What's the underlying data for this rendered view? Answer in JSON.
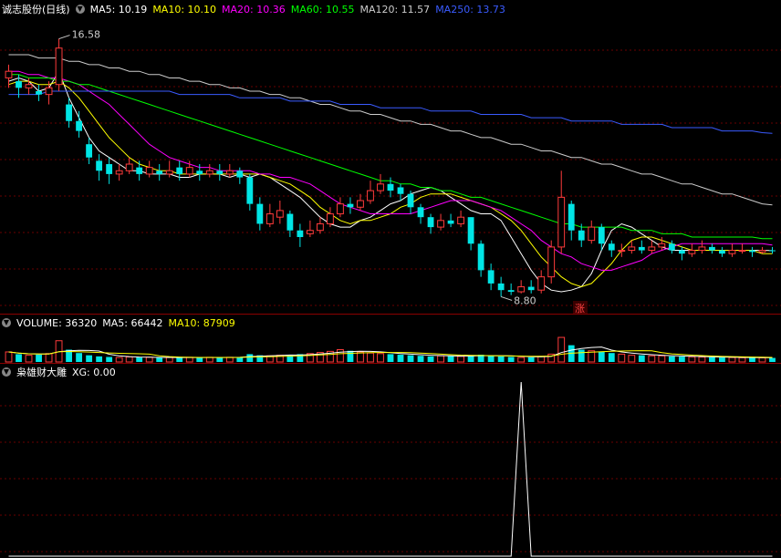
{
  "price_legend": {
    "title": "诚志股份(日线)",
    "items": [
      {
        "label": "MA5: 10.19",
        "color": "#ffffff"
      },
      {
        "label": "MA10: 10.10",
        "color": "#ffff00"
      },
      {
        "label": "MA20: 10.36",
        "color": "#ff00ff"
      },
      {
        "label": "MA60: 10.55",
        "color": "#00ff00"
      },
      {
        "label": "MA120: 11.57",
        "color": "#cccccc"
      },
      {
        "label": "MA250: 13.73",
        "color": "#3a5bff"
      }
    ]
  },
  "price_annotations": {
    "high": "16.58",
    "low": "8.80",
    "tag": "涨"
  },
  "volume_legend": {
    "items": [
      {
        "label": "VOLUME: 36320",
        "color": "#ffffff"
      },
      {
        "label": "MA5: 66442",
        "color": "#ffffff"
      },
      {
        "label": "MA10: 87909",
        "color": "#ffff00"
      }
    ]
  },
  "indicator_legend": {
    "title": "枭雄财大雕",
    "items": [
      {
        "label": "XG: 0.00",
        "color": "#ffffff"
      }
    ]
  },
  "colors": {
    "up": "#ff3b3b",
    "down": "#00e5e5",
    "grid": "#6a0000",
    "separator": "#8a0000"
  },
  "chart_data": {
    "type": "candlestick",
    "price_range": [
      8.4,
      17.2
    ],
    "ma_lines": {
      "ma5": {
        "color": "#ffffff",
        "values": [
          15.3,
          15.4,
          15.3,
          15.0,
          15.1,
          15.6,
          14.8,
          14.2,
          13.6,
          13.2,
          13.0,
          12.8,
          12.6,
          12.6,
          12.5,
          12.5,
          12.5,
          12.4,
          12.4,
          12.5,
          12.5,
          12.5,
          12.4,
          12.5,
          12.4,
          12.5,
          12.4,
          12.2,
          12.0,
          11.8,
          11.5,
          11.2,
          11.0,
          10.9,
          10.9,
          11.1,
          11.2,
          11.4,
          11.6,
          11.7,
          11.9,
          12.0,
          12.1,
          12.0,
          11.8,
          11.6,
          11.4,
          11.3,
          11.3,
          11.1,
          10.6,
          10.1,
          9.6,
          9.2,
          9.0,
          8.95,
          9.0,
          9.1,
          9.5,
          10.2,
          10.8,
          11.0,
          10.9,
          10.7,
          10.5,
          10.3,
          10.2,
          10.2,
          10.2,
          10.2,
          10.2,
          10.2,
          10.2,
          10.2,
          10.2,
          10.2,
          10.19
        ]
      },
      "ma10": {
        "color": "#ffff00",
        "values": [
          15.2,
          15.3,
          15.3,
          15.2,
          15.2,
          15.3,
          15.1,
          14.8,
          14.4,
          14.0,
          13.6,
          13.3,
          13.0,
          12.8,
          12.7,
          12.6,
          12.6,
          12.5,
          12.5,
          12.5,
          12.5,
          12.5,
          12.5,
          12.5,
          12.5,
          12.5,
          12.4,
          12.3,
          12.2,
          12.0,
          11.8,
          11.5,
          11.3,
          11.1,
          11.0,
          11.1,
          11.1,
          11.2,
          11.3,
          11.5,
          11.6,
          11.8,
          11.9,
          11.9,
          11.9,
          11.8,
          11.7,
          11.6,
          11.5,
          11.3,
          11.1,
          10.8,
          10.4,
          10.0,
          9.7,
          9.4,
          9.2,
          9.1,
          9.2,
          9.5,
          9.8,
          10.2,
          10.5,
          10.6,
          10.6,
          10.5,
          10.4,
          10.3,
          10.2,
          10.2,
          10.2,
          10.2,
          10.2,
          10.2,
          10.2,
          10.1,
          10.1
        ]
      },
      "ma20": {
        "color": "#ff00ff",
        "values": [
          15.6,
          15.6,
          15.5,
          15.5,
          15.4,
          15.4,
          15.3,
          15.2,
          15.0,
          14.8,
          14.6,
          14.3,
          14.0,
          13.7,
          13.4,
          13.2,
          13.0,
          12.9,
          12.8,
          12.7,
          12.7,
          12.6,
          12.6,
          12.6,
          12.6,
          12.5,
          12.5,
          12.4,
          12.4,
          12.3,
          12.2,
          12.0,
          11.8,
          11.6,
          11.5,
          11.4,
          11.3,
          11.3,
          11.3,
          11.3,
          11.3,
          11.4,
          11.5,
          11.6,
          11.7,
          11.7,
          11.7,
          11.6,
          11.5,
          11.4,
          11.2,
          11.0,
          10.8,
          10.5,
          10.3,
          10.1,
          10.0,
          9.8,
          9.7,
          9.6,
          9.6,
          9.7,
          9.8,
          9.9,
          10.1,
          10.2,
          10.3,
          10.4,
          10.4,
          10.4,
          10.4,
          10.4,
          10.4,
          10.4,
          10.4,
          10.4,
          10.36
        ]
      },
      "ma60": {
        "color": "#00ff00",
        "values": [
          15.5,
          15.5,
          15.4,
          15.4,
          15.4,
          15.3,
          15.3,
          15.2,
          15.2,
          15.1,
          15.0,
          14.9,
          14.8,
          14.7,
          14.6,
          14.5,
          14.4,
          14.3,
          14.2,
          14.1,
          14.0,
          13.9,
          13.8,
          13.7,
          13.6,
          13.5,
          13.4,
          13.3,
          13.2,
          13.1,
          13.0,
          12.9,
          12.8,
          12.7,
          12.6,
          12.5,
          12.4,
          12.3,
          12.3,
          12.2,
          12.2,
          12.1,
          12.1,
          12.0,
          12.0,
          11.9,
          11.8,
          11.8,
          11.7,
          11.6,
          11.5,
          11.4,
          11.3,
          11.2,
          11.1,
          11.0,
          11.0,
          10.9,
          10.9,
          10.9,
          10.9,
          10.9,
          10.8,
          10.8,
          10.8,
          10.7,
          10.7,
          10.7,
          10.6,
          10.6,
          10.6,
          10.6,
          10.6,
          10.6,
          10.6,
          10.55,
          10.55
        ]
      },
      "ma120": {
        "color": "#cccccc",
        "values": [
          16.1,
          16.1,
          16.1,
          16.0,
          16.0,
          16.0,
          15.9,
          15.9,
          15.8,
          15.8,
          15.7,
          15.7,
          15.6,
          15.6,
          15.5,
          15.5,
          15.4,
          15.4,
          15.3,
          15.3,
          15.2,
          15.2,
          15.1,
          15.1,
          15.0,
          15.0,
          14.9,
          14.9,
          14.8,
          14.8,
          14.7,
          14.6,
          14.6,
          14.5,
          14.4,
          14.4,
          14.3,
          14.3,
          14.2,
          14.1,
          14.1,
          14.0,
          14.0,
          13.9,
          13.8,
          13.8,
          13.7,
          13.6,
          13.6,
          13.5,
          13.4,
          13.4,
          13.3,
          13.2,
          13.2,
          13.1,
          13.0,
          13.0,
          12.9,
          12.8,
          12.8,
          12.7,
          12.6,
          12.5,
          12.5,
          12.4,
          12.3,
          12.2,
          12.2,
          12.1,
          12.0,
          11.9,
          11.9,
          11.8,
          11.7,
          11.6,
          11.57
        ]
      },
      "ma250": {
        "color": "#3a5bff",
        "values": [
          14.9,
          14.9,
          14.9,
          14.9,
          15.0,
          15.0,
          15.0,
          15.0,
          15.0,
          15.0,
          15.0,
          15.0,
          15.0,
          15.0,
          15.0,
          15.0,
          15.0,
          14.9,
          14.9,
          14.9,
          14.9,
          14.9,
          14.9,
          14.8,
          14.8,
          14.8,
          14.8,
          14.8,
          14.7,
          14.7,
          14.7,
          14.7,
          14.7,
          14.6,
          14.6,
          14.6,
          14.6,
          14.5,
          14.5,
          14.5,
          14.5,
          14.5,
          14.4,
          14.4,
          14.4,
          14.4,
          14.4,
          14.3,
          14.3,
          14.3,
          14.3,
          14.3,
          14.2,
          14.2,
          14.2,
          14.2,
          14.1,
          14.1,
          14.1,
          14.1,
          14.1,
          14.0,
          14.0,
          14.0,
          14.0,
          14.0,
          13.9,
          13.9,
          13.9,
          13.9,
          13.9,
          13.8,
          13.8,
          13.8,
          13.8,
          13.75,
          13.73
        ]
      }
    },
    "candles": [
      [
        15.4,
        15.6,
        15.8,
        15.1
      ],
      [
        15.3,
        15.1,
        15.5,
        14.8
      ],
      [
        15.1,
        15.2,
        15.4,
        14.9
      ],
      [
        15.0,
        14.9,
        15.2,
        14.7
      ],
      [
        14.9,
        15.1,
        15.3,
        14.6
      ],
      [
        15.2,
        16.3,
        16.58,
        15.0
      ],
      [
        14.6,
        14.1,
        14.8,
        13.9
      ],
      [
        14.1,
        13.8,
        14.4,
        13.6
      ],
      [
        13.4,
        13.0,
        13.6,
        12.8
      ],
      [
        12.9,
        12.6,
        13.1,
        12.3
      ],
      [
        12.8,
        12.5,
        13.0,
        12.2
      ],
      [
        12.5,
        12.6,
        12.8,
        12.3
      ],
      [
        12.6,
        12.8,
        13.0,
        12.5
      ],
      [
        12.7,
        12.5,
        12.9,
        12.3
      ],
      [
        12.5,
        12.7,
        12.9,
        12.4
      ],
      [
        12.6,
        12.5,
        12.8,
        12.3
      ],
      [
        12.5,
        12.6,
        12.9,
        12.4
      ],
      [
        12.7,
        12.5,
        12.9,
        12.3
      ],
      [
        12.5,
        12.7,
        12.9,
        12.4
      ],
      [
        12.6,
        12.5,
        12.8,
        12.3
      ],
      [
        12.5,
        12.6,
        12.8,
        12.4
      ],
      [
        12.6,
        12.5,
        12.8,
        12.3
      ],
      [
        12.5,
        12.6,
        12.8,
        12.4
      ],
      [
        12.6,
        12.4,
        12.7,
        12.2
      ],
      [
        12.4,
        11.6,
        12.5,
        11.4
      ],
      [
        11.6,
        11.0,
        11.8,
        10.8
      ],
      [
        11.0,
        11.3,
        11.6,
        10.9
      ],
      [
        11.2,
        11.4,
        11.7,
        11.0
      ],
      [
        11.3,
        10.8,
        11.4,
        10.6
      ],
      [
        10.8,
        10.6,
        11.0,
        10.3
      ],
      [
        10.7,
        10.8,
        11.1,
        10.6
      ],
      [
        10.8,
        11.0,
        11.2,
        10.7
      ],
      [
        11.0,
        11.3,
        11.5,
        10.9
      ],
      [
        11.3,
        11.6,
        11.8,
        11.2
      ],
      [
        11.6,
        11.5,
        11.8,
        11.3
      ],
      [
        11.5,
        11.7,
        11.9,
        11.4
      ],
      [
        11.7,
        12.0,
        12.3,
        11.6
      ],
      [
        12.0,
        12.2,
        12.5,
        11.9
      ],
      [
        12.2,
        12.0,
        12.4,
        11.8
      ],
      [
        12.1,
        11.9,
        12.2,
        11.7
      ],
      [
        11.9,
        11.5,
        12.0,
        11.3
      ],
      [
        11.5,
        11.2,
        11.6,
        11.0
      ],
      [
        11.2,
        10.9,
        11.3,
        10.7
      ],
      [
        10.9,
        11.1,
        11.3,
        10.8
      ],
      [
        11.1,
        11.0,
        11.3,
        10.9
      ],
      [
        11.0,
        11.2,
        11.4,
        10.9
      ],
      [
        11.2,
        10.4,
        11.2,
        10.2
      ],
      [
        10.4,
        9.6,
        10.5,
        9.4
      ],
      [
        9.6,
        9.2,
        9.8,
        9.0
      ],
      [
        9.2,
        9.0,
        9.4,
        8.8
      ],
      [
        9.0,
        8.95,
        9.2,
        8.85
      ],
      [
        8.95,
        9.1,
        9.3,
        8.9
      ],
      [
        9.1,
        9.0,
        9.3,
        8.9
      ],
      [
        9.0,
        9.4,
        9.6,
        8.9
      ],
      [
        9.4,
        10.3,
        10.5,
        9.2
      ],
      [
        10.3,
        11.8,
        12.6,
        10.1
      ],
      [
        11.6,
        10.8,
        11.7,
        10.5
      ],
      [
        10.8,
        10.5,
        11.0,
        10.3
      ],
      [
        10.5,
        10.9,
        11.1,
        10.4
      ],
      [
        10.9,
        10.4,
        11.0,
        10.2
      ],
      [
        10.4,
        10.2,
        10.5,
        10.0
      ],
      [
        10.2,
        10.2,
        10.4,
        10.0
      ],
      [
        10.2,
        10.3,
        10.5,
        10.1
      ],
      [
        10.3,
        10.2,
        10.5,
        10.1
      ],
      [
        10.2,
        10.3,
        10.5,
        10.1
      ],
      [
        10.3,
        10.4,
        10.6,
        10.2
      ],
      [
        10.4,
        10.2,
        10.5,
        10.1
      ],
      [
        10.2,
        10.1,
        10.3,
        9.9
      ],
      [
        10.1,
        10.2,
        10.4,
        10.0
      ],
      [
        10.2,
        10.3,
        10.5,
        10.1
      ],
      [
        10.3,
        10.2,
        10.4,
        10.1
      ],
      [
        10.2,
        10.1,
        10.3,
        10.0
      ],
      [
        10.1,
        10.2,
        10.4,
        10.0
      ],
      [
        10.2,
        10.2,
        10.4,
        10.1
      ],
      [
        10.2,
        10.15,
        10.3,
        10.0
      ],
      [
        10.15,
        10.2,
        10.3,
        10.1
      ],
      [
        10.2,
        10.19,
        10.3,
        10.1
      ]
    ],
    "volume": {
      "range": [
        0,
        400000
      ],
      "values": [
        90000,
        70000,
        60000,
        65000,
        75000,
        190000,
        110000,
        80000,
        60000,
        50000,
        45000,
        40000,
        45000,
        40000,
        42000,
        38000,
        40000,
        38000,
        42000,
        40000,
        42000,
        40000,
        42000,
        45000,
        70000,
        60000,
        55000,
        60000,
        65000,
        70000,
        75000,
        85000,
        95000,
        110000,
        100000,
        90000,
        80000,
        75000,
        70000,
        65000,
        60000,
        55000,
        50000,
        55000,
        52000,
        50000,
        60000,
        65000,
        55000,
        50000,
        45000,
        40000,
        42000,
        50000,
        70000,
        220000,
        150000,
        110000,
        100000,
        90000,
        80000,
        70000,
        60000,
        60000,
        55000,
        55000,
        50000,
        48000,
        46000,
        44000,
        42000,
        40000,
        40000,
        38000,
        38000,
        37000,
        36320
      ],
      "ma5_color": "#ffffff",
      "ma10_color": "#ffff00"
    },
    "xg_signal": {
      "range": [
        0,
        1
      ],
      "values": [
        0,
        0,
        0,
        0,
        0,
        0,
        0,
        0,
        0,
        0,
        0,
        0,
        0,
        0,
        0,
        0,
        0,
        0,
        0,
        0,
        0,
        0,
        0,
        0,
        0,
        0,
        0,
        0,
        0,
        0,
        0,
        0,
        0,
        0,
        0,
        0,
        0,
        0,
        0,
        0,
        0,
        0,
        0,
        0,
        0,
        0,
        0,
        0,
        0,
        0,
        0,
        1,
        0,
        0,
        0,
        0,
        0,
        0,
        0,
        0,
        0,
        0,
        0,
        0,
        0,
        0,
        0,
        0,
        0,
        0,
        0,
        0,
        0,
        0,
        0,
        0,
        0
      ]
    }
  }
}
